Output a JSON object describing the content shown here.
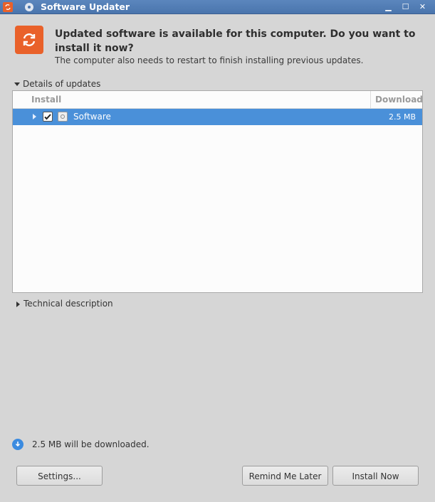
{
  "window": {
    "title": "Software Updater"
  },
  "colors": {
    "accent": "#e9612a",
    "selection": "#4a90d9",
    "titlebar": "#4a75ad"
  },
  "message": {
    "headline": "Updated software is available for this computer. Do you want to install it now?",
    "subline": "The computer also needs to restart to finish installing previous updates."
  },
  "details": {
    "label": "Details of updates",
    "columns": {
      "install": "Install",
      "download": "Download"
    },
    "rows": [
      {
        "name": "Software",
        "size": "2.5 MB",
        "checked": true,
        "icon": "package-icon"
      }
    ]
  },
  "technical": {
    "label": "Technical description"
  },
  "status": {
    "text": "2.5 MB will be downloaded."
  },
  "buttons": {
    "settings": "Settings...",
    "remind": "Remind Me Later",
    "install": "Install Now"
  }
}
